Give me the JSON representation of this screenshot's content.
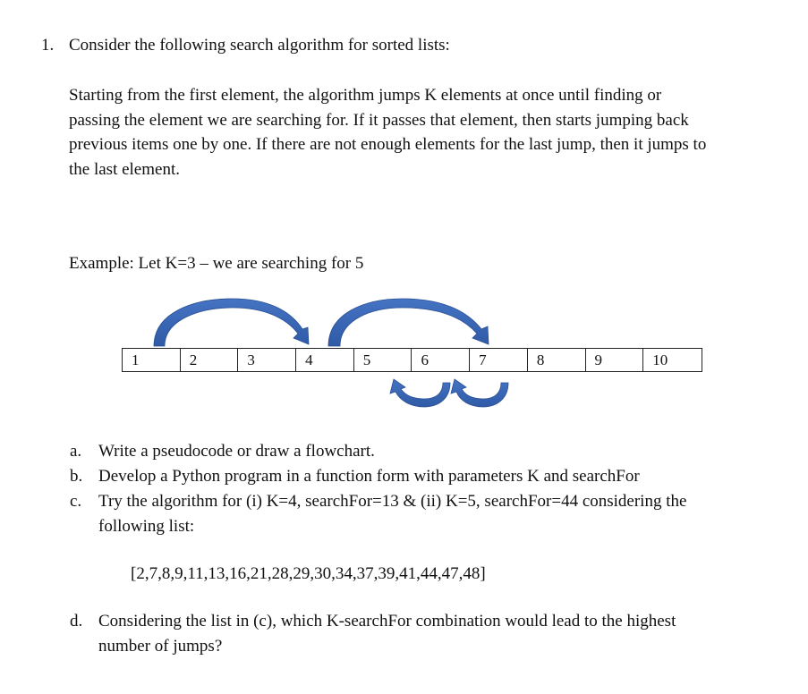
{
  "question": {
    "number": "1.",
    "title": "Consider the following search algorithm for sorted lists:",
    "description_lines": [
      "Starting from the first element, the algorithm jumps K elements at once until finding or",
      "passing the element we are searching for. If it passes that element, then starts jumping back",
      "previous items one by one. If there are not enough elements for the last jump, then it jumps to",
      "the last element."
    ],
    "example": "Example: Let K=3 – we are searching for 5",
    "example_array": [
      "1",
      "2",
      "3",
      "4",
      "5",
      "6",
      "7",
      "8",
      "9",
      "10"
    ],
    "diagram": {
      "forward_jumps": [
        {
          "from": "1",
          "to": "4"
        },
        {
          "from": "4",
          "to": "7"
        }
      ],
      "backward_jumps": [
        {
          "from": "7",
          "to": "6"
        },
        {
          "from": "6",
          "to": "5"
        }
      ],
      "arrow_color": "#3a66b3",
      "arrow_edge_color": "#2a4f94"
    },
    "parts": [
      {
        "label": "a.",
        "lines": [
          "Write a pseudocode or draw a flowchart."
        ]
      },
      {
        "label": "b.",
        "lines": [
          "Develop a Python program in a function form with parameters K and searchFor"
        ]
      },
      {
        "label": "c.",
        "lines": [
          "Try the algorithm for (i) K=4, searchFor=13 & (ii) K=5, searchFor=44 considering the",
          "following list:"
        ]
      },
      {
        "label": "d.",
        "lines": [
          "Considering the list in (c), which K-searchFor combination would lead to the highest",
          "number of jumps?"
        ]
      }
    ],
    "list": "[2,7,8,9,11,13,16,21,28,29,30,34,37,39,41,44,47,48]"
  }
}
